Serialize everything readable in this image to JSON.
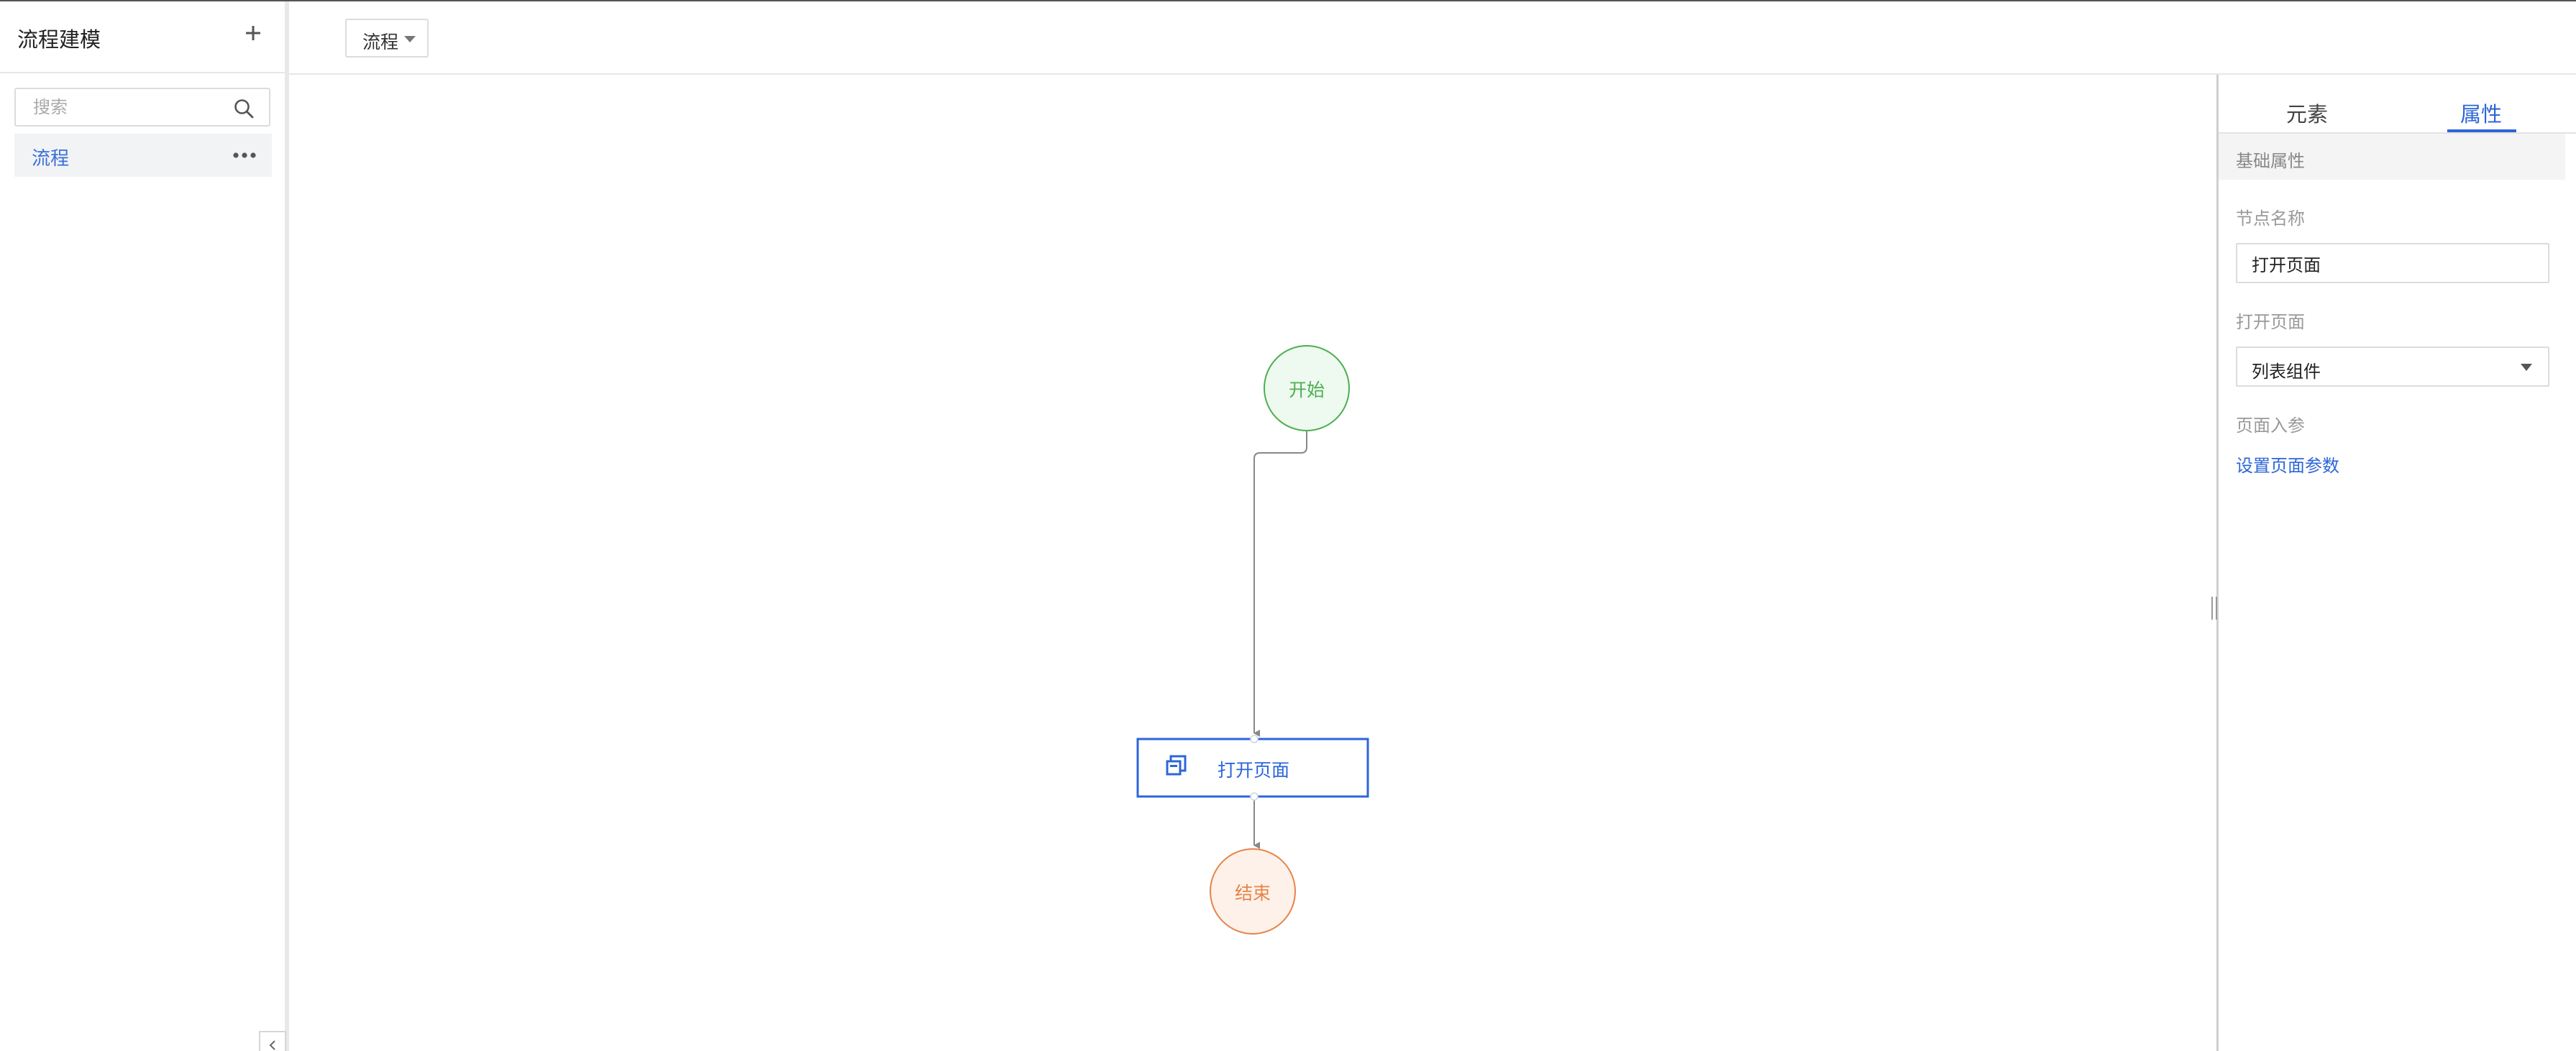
{
  "sidebar": {
    "title": "流程建模",
    "search": {
      "placeholder": "搜索",
      "value": ""
    },
    "items": [
      {
        "label": "流程"
      }
    ]
  },
  "toolbar": {
    "flow_select": {
      "selected": "流程"
    }
  },
  "canvas": {
    "nodes": {
      "start": {
        "label": "开始",
        "color": "#4caf50"
      },
      "open_page": {
        "label": "打开页面",
        "color": "#2c66d8"
      },
      "end": {
        "label": "结束",
        "color": "#e8844a"
      }
    }
  },
  "panel": {
    "tabs": [
      {
        "label": "元素",
        "active": false
      },
      {
        "label": "属性",
        "active": true
      }
    ],
    "section_title": "基础属性",
    "fields": {
      "node_name": {
        "label": "节点名称",
        "value": "打开页面"
      },
      "open_page": {
        "label": "打开页面",
        "selected": "列表组件"
      },
      "page_params": {
        "label": "页面入参",
        "link_text": "设置页面参数"
      }
    }
  },
  "colors": {
    "accent": "#2c66d8",
    "start_node": "#4caf50",
    "end_node": "#e8844a"
  }
}
